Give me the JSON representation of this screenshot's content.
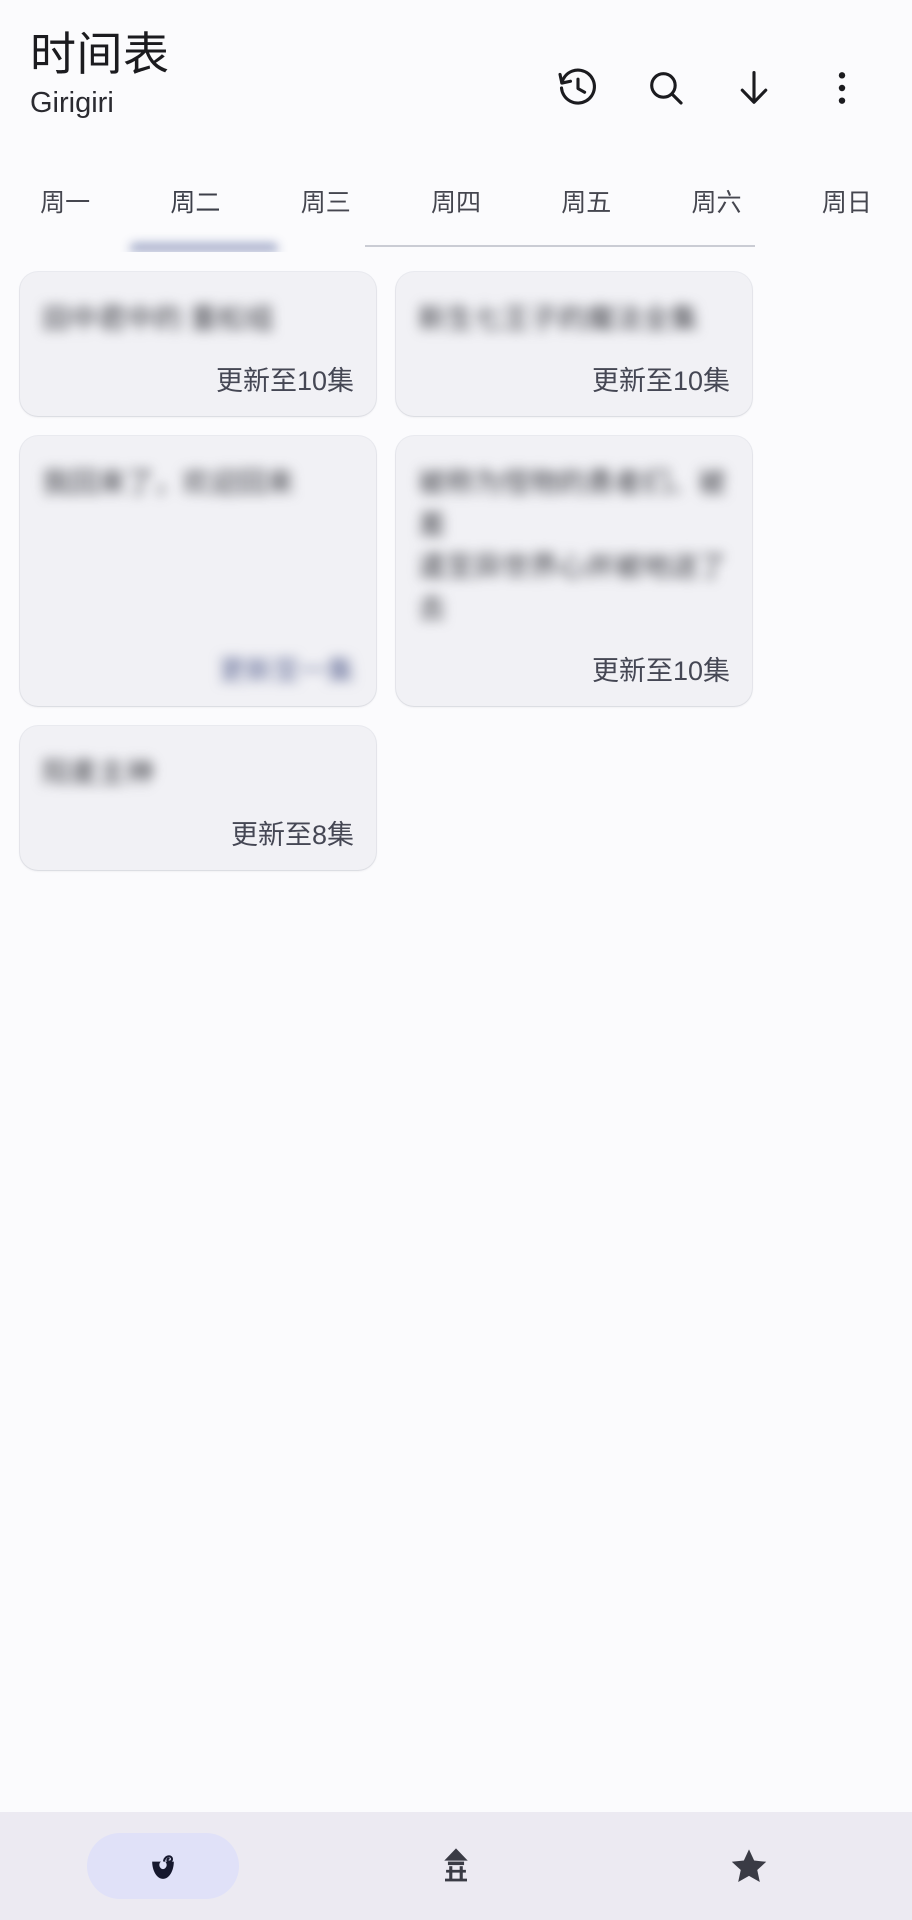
{
  "header": {
    "title": "时间表",
    "subtitle": "Girigiri",
    "actions": [
      {
        "name": "history-icon",
        "label": "历史"
      },
      {
        "name": "search-icon",
        "label": "搜索"
      },
      {
        "name": "download-icon",
        "label": "下载"
      },
      {
        "name": "overflow-menu-icon",
        "label": "更多"
      }
    ]
  },
  "tabs": {
    "active_index": 1,
    "items": [
      {
        "label": "周一"
      },
      {
        "label": "周二"
      },
      {
        "label": "周三"
      },
      {
        "label": "周四"
      },
      {
        "label": "周五"
      },
      {
        "label": "周六"
      },
      {
        "label": "周日"
      }
    ]
  },
  "cards": [
    {
      "title": "田中君中的 重松组",
      "status": "更新至10集",
      "status_redacted": false,
      "lines": 1
    },
    {
      "title": "新生七王子的魔法全集",
      "status": "更新至10集",
      "status_redacted": false,
      "lines": 1
    },
    {
      "title": "我回来了，欢迎回来",
      "status": "更新至一集",
      "status_redacted": true,
      "lines": 1
    },
    {
      "title": "被称为怪物的勇者们、被差\n遣至异世界心并被地送了去",
      "status": "更新至10集",
      "status_redacted": false,
      "lines": 2
    },
    {
      "title": "阳麦主神",
      "status": "更新至8集",
      "status_redacted": false,
      "lines": 1
    }
  ],
  "bottom_nav": {
    "active_index": 0,
    "items": [
      {
        "name": "schedule-icon",
        "label": "时间表"
      },
      {
        "name": "home-icon",
        "label": "首页"
      },
      {
        "name": "star-icon",
        "label": "收藏"
      }
    ]
  },
  "colors": {
    "background": "#fbfbfd",
    "card": "#f1f1f5",
    "accent": "#e0e1f8",
    "tab_indicator": "#9aa3c4",
    "text_primary": "#1b1b1f",
    "text_secondary": "#45464f",
    "bottom_nav_bg": "#eceaf2"
  }
}
